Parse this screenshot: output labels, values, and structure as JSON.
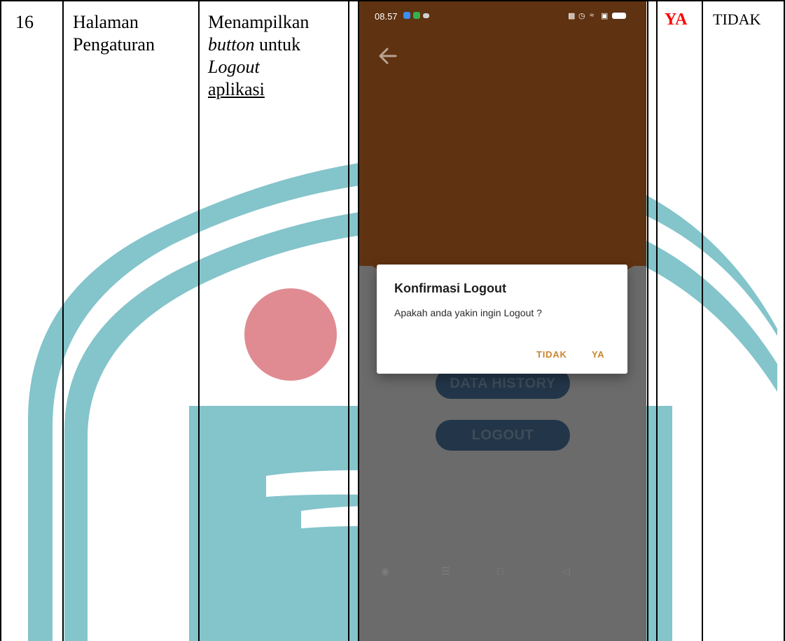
{
  "table": {
    "number": "16",
    "menu": [
      "Halaman",
      "Pengaturan"
    ],
    "description": {
      "line1": "Menampilkan",
      "line2_italic": "button",
      "line2_rest": " untuk",
      "line3_italic": "Logout",
      "line4_underlined": "aplikasi"
    },
    "result_yes": "YA",
    "result_no": "TIDAK"
  },
  "phone": {
    "status_time": "08.57",
    "status_icons": [
      "vibrate-icon",
      "alarm-icon",
      "wifi-icon",
      "signal-icon",
      "battery-icon"
    ],
    "buttons": {
      "history": "DATA HISTORY",
      "logout": "LOGOUT"
    },
    "dialog": {
      "title": "Konfirmasi Logout",
      "message": "Apakah anda yakin ingin Logout ?",
      "cancel": "TIDAK",
      "confirm": "YA"
    },
    "nav_icons": [
      "home-circle-icon",
      "menu-lines-icon",
      "square-icon",
      "back-triangle-icon"
    ]
  },
  "colors": {
    "phone_header": "#5f3211",
    "dialog_button": "#c98530",
    "yes_text": "#ff0000",
    "watermark": "#84c4cb",
    "watermark_dot": "#e08b92"
  }
}
